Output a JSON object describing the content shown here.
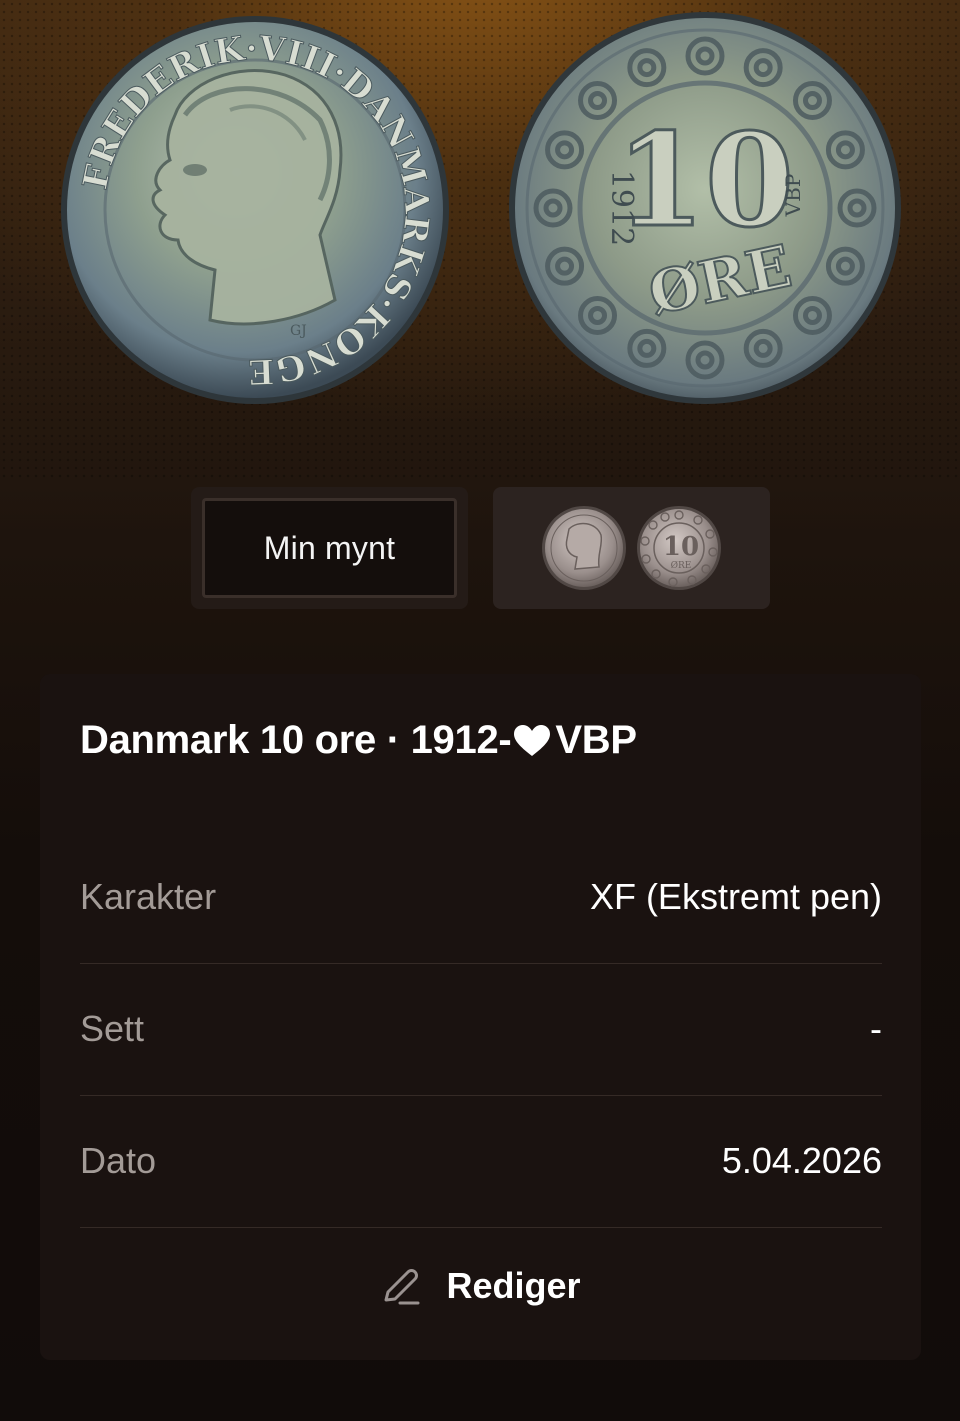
{
  "thumbnails": {
    "text_label": "Min mynt"
  },
  "coin": {
    "obverse_legend": "FREDERIK·VIII·DANMARKS·KONGE",
    "mint_mark": "GJ",
    "reverse_denomination": "10",
    "reverse_unit": "ØRE",
    "reverse_year": "1912",
    "reverse_initials": "VBP"
  },
  "card": {
    "title_part1": "Danmark 10 ore · 1912-",
    "title_part2": "VBP",
    "rows": [
      {
        "label": "Karakter",
        "value": "XF (Ekstremt pen)"
      },
      {
        "label": "Sett",
        "value": "-"
      },
      {
        "label": "Dato",
        "value": "5.04.2026"
      }
    ],
    "edit_label": "Rediger"
  },
  "colors": {
    "background": "#140d0a",
    "card": "#1a1210",
    "accent_glow": "#965c16",
    "label_gray": "#a39b97"
  }
}
